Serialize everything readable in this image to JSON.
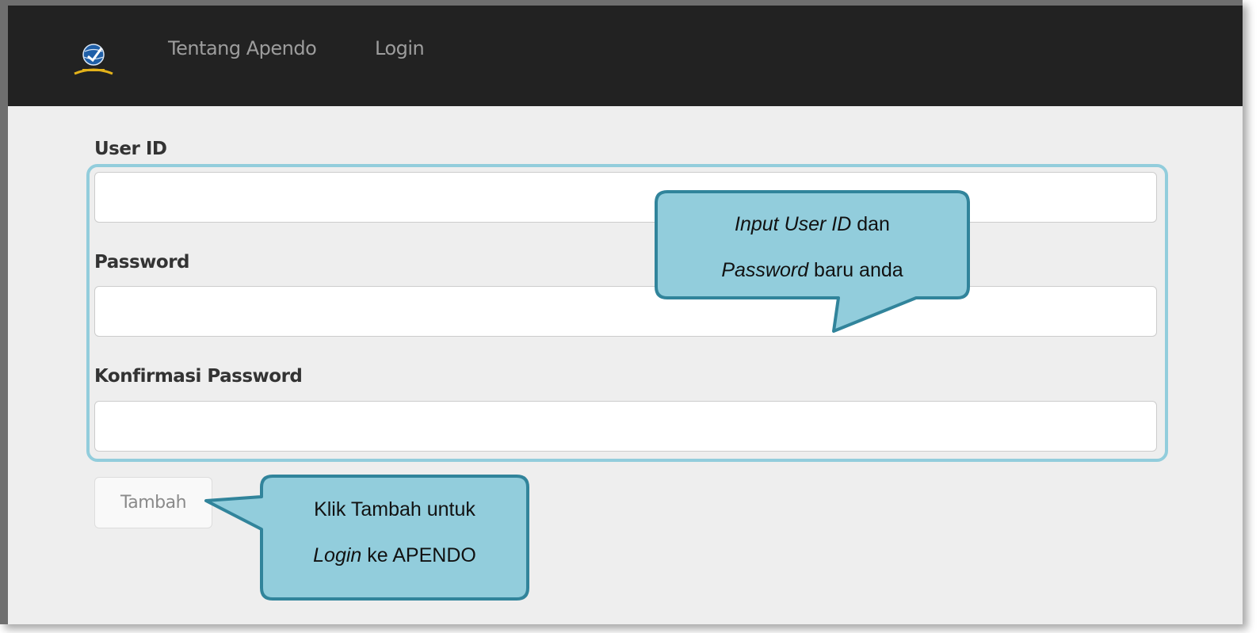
{
  "navbar": {
    "logo_icon": "apendo-globe-emblem-icon",
    "links": [
      {
        "label": "Tentang Apendo"
      },
      {
        "label": "Login"
      }
    ],
    "background": "#222222",
    "link_color": "#9d9d9d"
  },
  "form": {
    "fields": [
      {
        "label": "User ID",
        "value": "",
        "placeholder": ""
      },
      {
        "label": "Password",
        "value": "",
        "placeholder": ""
      },
      {
        "label": "Konfirmasi Password",
        "value": "",
        "placeholder": ""
      }
    ],
    "submit_label": "Tambah"
  },
  "annotations": {
    "fields_callout": {
      "line1_italic": "Input User ID",
      "line1_rest": " dan",
      "line2_italic": "Password",
      "line2_rest": " baru anda"
    },
    "button_callout": {
      "line1": "Klik Tambah untuk",
      "line2_italic": "Login",
      "line2_rest": " ke APENDO"
    },
    "callout_fill": "#92cddc",
    "callout_stroke": "#31849b"
  }
}
